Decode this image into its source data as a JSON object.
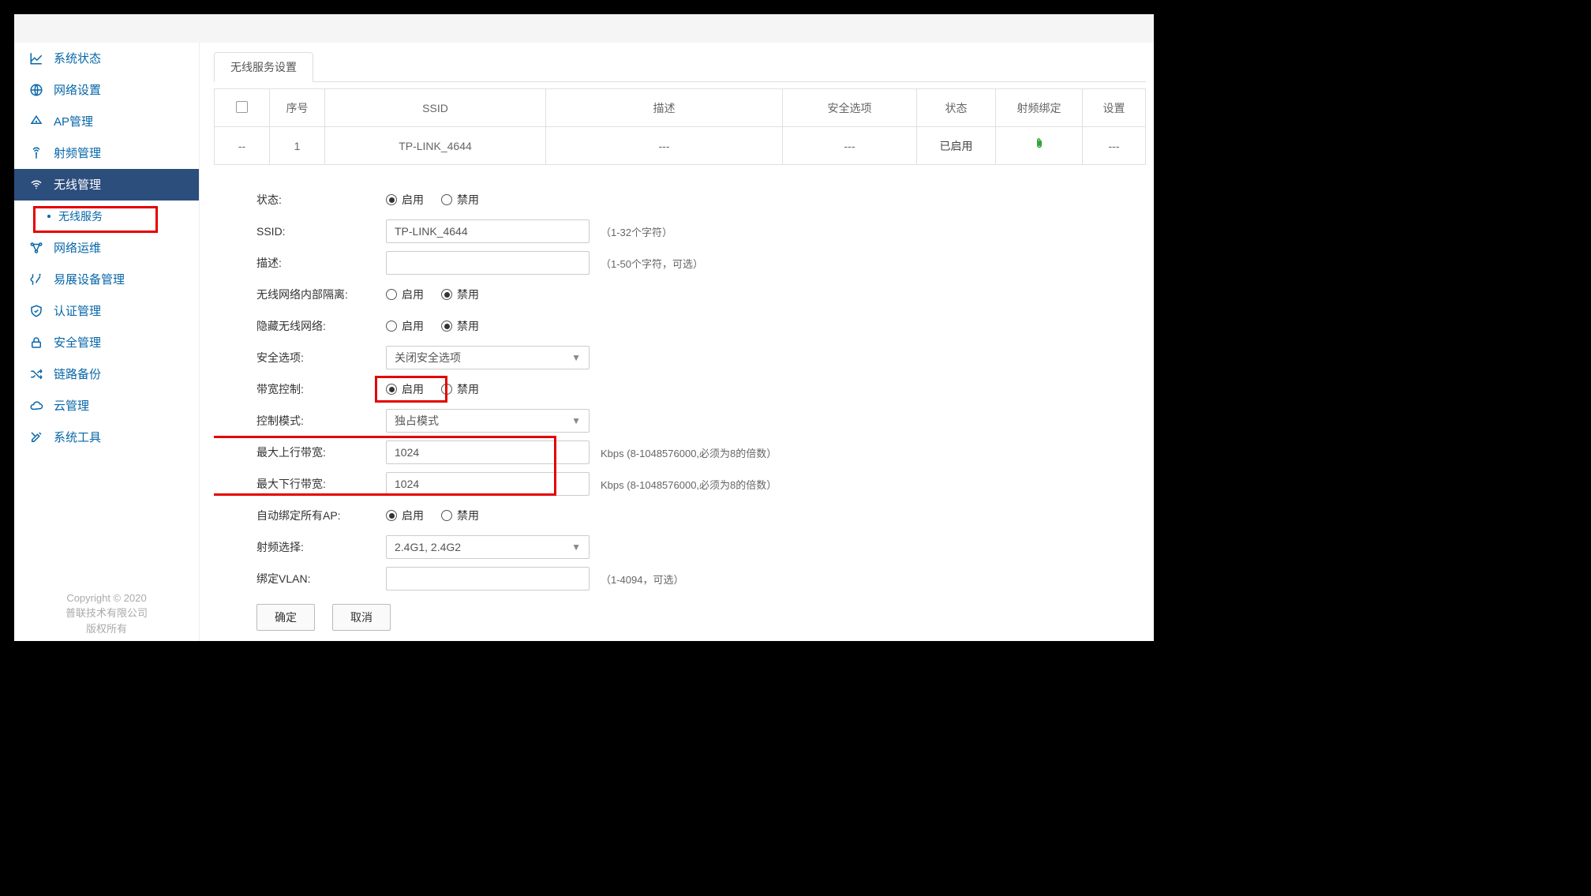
{
  "sidebar": {
    "items": [
      {
        "label": "系统状态",
        "icon": "chart"
      },
      {
        "label": "网络设置",
        "icon": "globe"
      },
      {
        "label": "AP管理",
        "icon": "ap"
      },
      {
        "label": "射频管理",
        "icon": "antenna"
      },
      {
        "label": "无线管理",
        "icon": "wifi",
        "active": true,
        "sub": [
          {
            "label": "无线服务",
            "highlight": true
          }
        ]
      },
      {
        "label": "网络运维",
        "icon": "nodes"
      },
      {
        "label": "易展设备管理",
        "icon": "device"
      },
      {
        "label": "认证管理",
        "icon": "shield"
      },
      {
        "label": "安全管理",
        "icon": "lock"
      },
      {
        "label": "链路备份",
        "icon": "shuffle"
      },
      {
        "label": "云管理",
        "icon": "cloud"
      },
      {
        "label": "系统工具",
        "icon": "tools"
      }
    ]
  },
  "copyright": {
    "line1": "Copyright © 2020",
    "line2": "普联技术有限公司",
    "line3": "版权所有"
  },
  "tabs": {
    "wireless_settings": "无线服务设置"
  },
  "table": {
    "headers": {
      "index": "序号",
      "ssid": "SSID",
      "desc": "描述",
      "security": "安全选项",
      "state": "状态",
      "rfbind": "射频绑定",
      "action": "设置"
    },
    "row": {
      "select": "--",
      "index": "1",
      "ssid": "TP-LINK_4644",
      "desc": "---",
      "security": "---",
      "state": "已启用",
      "action": "---"
    }
  },
  "form": {
    "labels": {
      "state": "状态:",
      "ssid": "SSID:",
      "desc": "描述:",
      "isolation": "无线网络内部隔离:",
      "hide": "隐藏无线网络:",
      "security": "安全选项:",
      "bwctrl": "带宽控制:",
      "ctrlmode": "控制模式:",
      "upbw": "最大上行带宽:",
      "downbw": "最大下行带宽:",
      "autoap": "自动绑定所有AP:",
      "rfsel": "射频选择:",
      "vlan": "绑定VLAN:"
    },
    "radio": {
      "enable": "启用",
      "disable": "禁用"
    },
    "values": {
      "ssid": "TP-LINK_4644",
      "desc": "",
      "security_option": "关闭安全选项",
      "ctrl_mode": "独占模式",
      "upbw": "1024",
      "downbw": "1024",
      "rf_select": "2.4G1, 2.4G2",
      "vlan": ""
    },
    "hints": {
      "ssid": "（1-32个字符）",
      "desc": "（1-50个字符，可选）",
      "upbw": "Kbps (8-1048576000,必须为8的倍数）",
      "downbw": "Kbps (8-1048576000,必须为8的倍数）",
      "vlan": "（1-4094，可选）"
    },
    "buttons": {
      "ok": "确定",
      "cancel": "取消"
    }
  }
}
